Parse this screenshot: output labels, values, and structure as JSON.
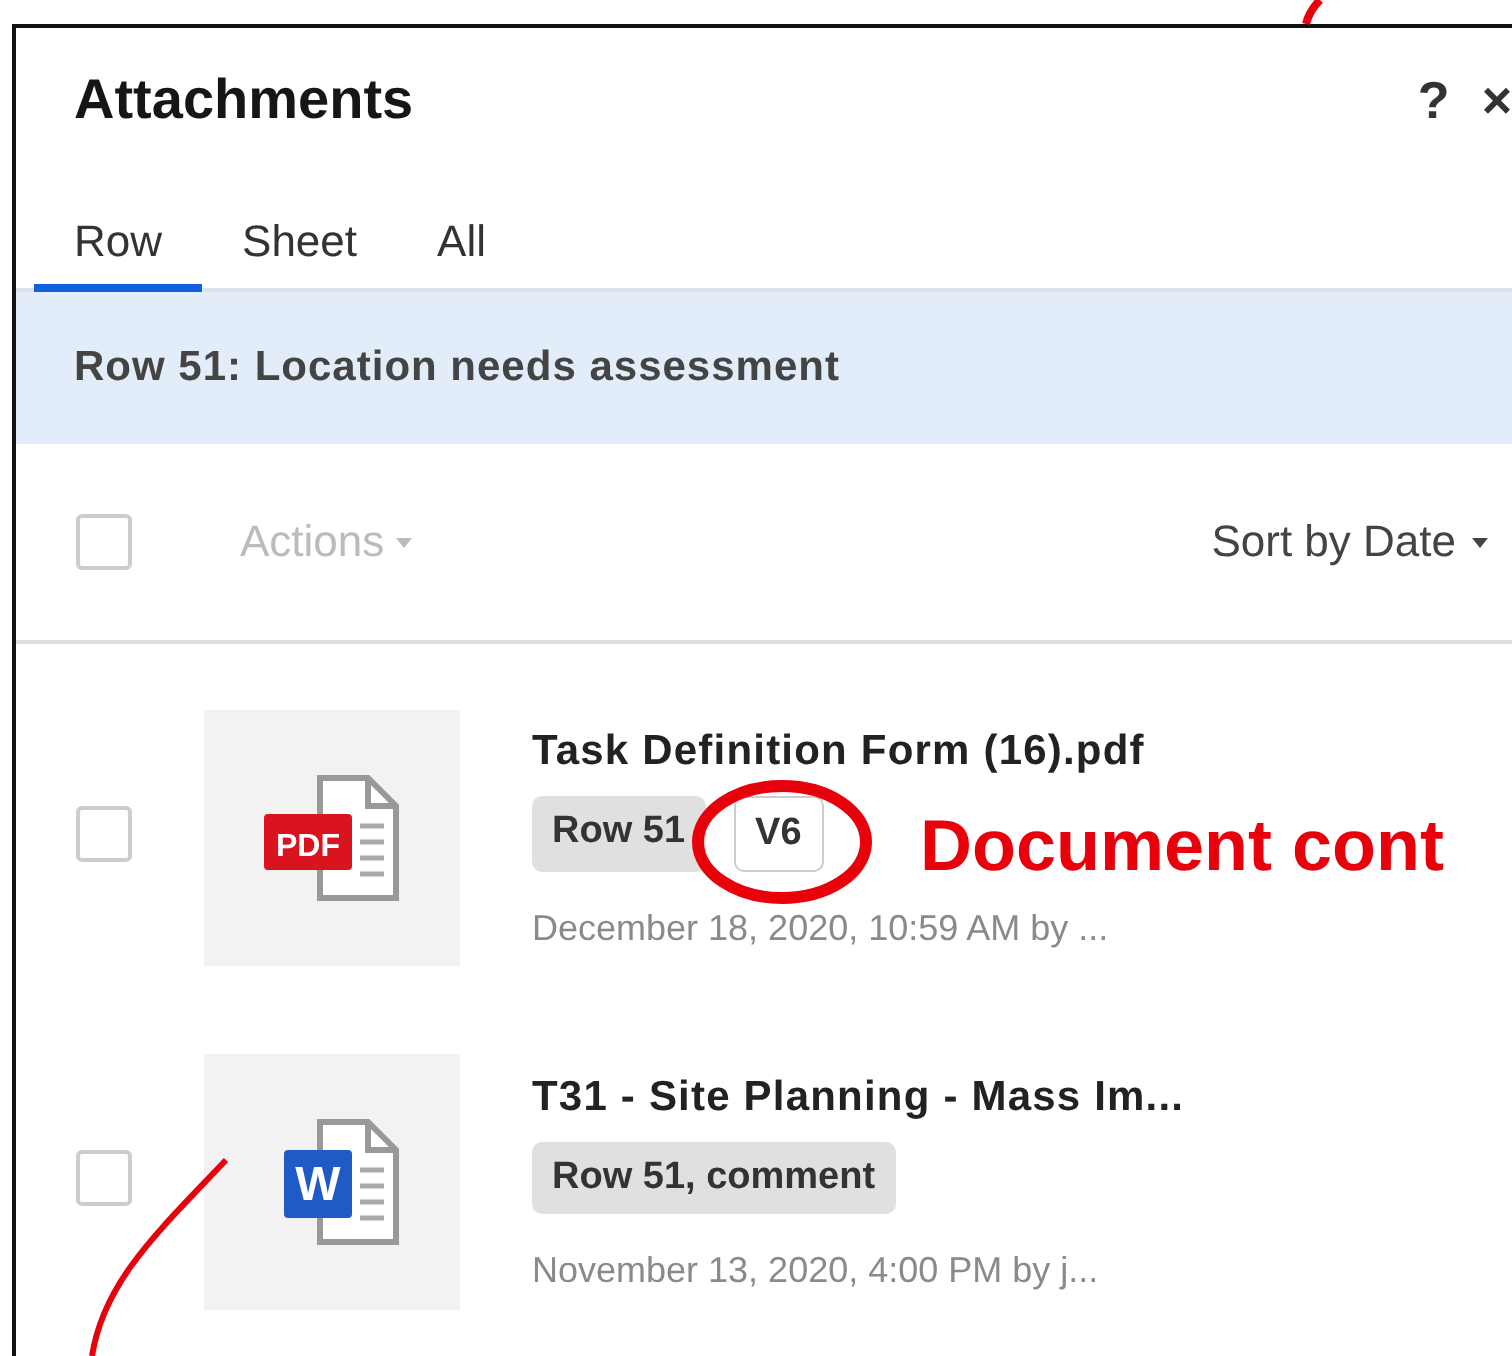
{
  "panel": {
    "title": "Attachments",
    "help": "?",
    "close": "×"
  },
  "tabs": [
    {
      "label": "Row",
      "selected": true
    },
    {
      "label": "Sheet",
      "selected": false
    },
    {
      "label": "All",
      "selected": false
    }
  ],
  "context": "Row 51: Location needs assessment",
  "toolbar": {
    "select_all_checked": false,
    "actions": {
      "label": "Actions",
      "disabled": true
    },
    "sort": "Sort by Date"
  },
  "files": [
    {
      "kind": "pdf",
      "icon_label": "PDF",
      "checked": false,
      "name": "Task Definition Form (16).pdf",
      "tags": [
        {
          "kind": "location",
          "text": "Row 51"
        },
        {
          "kind": "version",
          "text": "V6"
        }
      ],
      "meta": "December 18, 2020, 10:59 AM by ..."
    },
    {
      "kind": "word",
      "icon_label": "W",
      "checked": false,
      "name": "T31 - Site Planning - Mass Im...",
      "tags": [
        {
          "kind": "location",
          "text": "Row 51, comment"
        }
      ],
      "meta": "November 13, 2020, 4:00 PM by j..."
    }
  ],
  "annotation": {
    "callout": "Document cont"
  }
}
